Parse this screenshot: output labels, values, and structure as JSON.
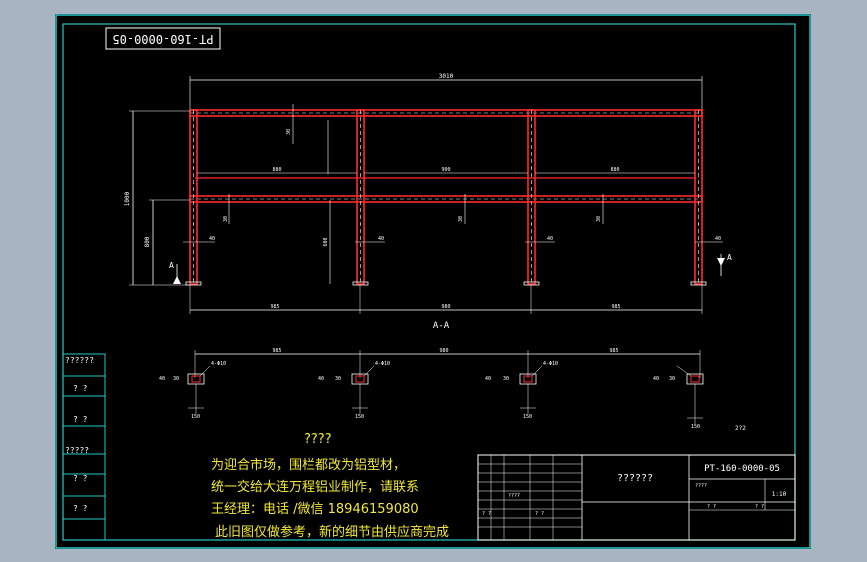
{
  "drawing_number_top": "PT-160-0000-05",
  "drawing_number_block": "PT-160-0000-05",
  "section_label": "A-A",
  "section_marker": "A",
  "left_table": [
    "??????",
    "? ?",
    "? ?",
    "?????",
    "? ?",
    "? ?"
  ],
  "notes": {
    "header": "????",
    "line1": "为迎合市场，围栏都改为铝型材，",
    "line2": "统一交给大连万程铝业制作，请联系",
    "line3": "王经理：电话 /微信 18946159080",
    "line4": "此旧图仅做参考，新的细节由供应商完成"
  },
  "title_block": {
    "title": "??????",
    "scale": "1:10",
    "small_cells": [
      "????",
      "? ?",
      "? ?",
      "????",
      "? ?",
      "? ?"
    ]
  },
  "dimensions": {
    "overall_width": "3010",
    "overall_height": "1000",
    "rail_height": "800",
    "bay_spans": [
      "880",
      "900",
      "880"
    ],
    "bottom_spans": [
      "985",
      "980",
      "985"
    ],
    "plan_spans": [
      "985",
      "980",
      "985"
    ],
    "offset": "40",
    "tube": "30",
    "post_height": "600",
    "hole_label": "4-Φ10",
    "plate": "150",
    "page_tag": "2?2"
  },
  "colors": {
    "frame_line": "#ff2a2a",
    "dash_line": "#ffffff",
    "dimension": "#ffffff",
    "border": "#29c6c6",
    "note_text": "#f2e838",
    "background": "#000000"
  }
}
